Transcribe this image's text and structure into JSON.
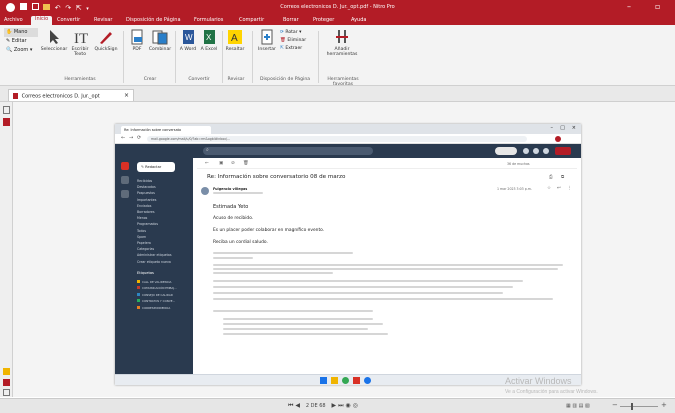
{
  "app": {
    "title": "Correos electronicos D. Jur._opt.pdf - Nitro Pro",
    "quick_icons": [
      "save-icon",
      "print-icon",
      "folder-icon",
      "undo-icon",
      "redo-icon",
      "pointer-icon",
      "dropdown-icon"
    ]
  },
  "menu": {
    "tabs": [
      "Archivo",
      "Inicio",
      "Convertir",
      "Revisar",
      "Disposición de Página",
      "Formularios",
      "Compartir",
      "Borrar",
      "Proteger",
      "Ayuda"
    ],
    "active": "Inicio"
  },
  "ribbon": {
    "left_tools": [
      "Mano",
      "Editar",
      "Zoom"
    ],
    "herramientas": [
      "Seleccionar",
      "Escribir Texto",
      "QuickSign"
    ],
    "crear": [
      "PDF",
      "Combinar"
    ],
    "convertir": [
      "A Word",
      "A Excel"
    ],
    "revisar": [
      "Resaltar"
    ],
    "disposicion": [
      "Insertar",
      "Rotar",
      "Eliminar",
      "Extraer"
    ],
    "favoritas": [
      "Añadir herramientas"
    ],
    "groups": [
      "Herramientas",
      "Crear",
      "Convertir",
      "Revisar",
      "Disposición de Página",
      "Herramientas favoritas"
    ]
  },
  "document": {
    "tab_label": "Correos electronicos D. Jur._opt"
  },
  "email": {
    "browser_tab": "Re: Información sobre conversato",
    "url": "mail.google.com/mail/u/0/?ab=rm&ogbl#inbox/...",
    "subject": "Re: Información sobre conversatorio 08 de marzo",
    "sender": "Fulgencio villegas",
    "date": "1 mar 2023 3:03 p.m.",
    "greeting": "Estimada Yeto",
    "line1": "Acuso de recibido.",
    "line2": "Es un placer poder colaborar en magnífico evento.",
    "line3": "Reciba un cordial saludo.",
    "sidebar_items": [
      "Recibidos",
      "Destacados",
      "Pospuestos",
      "Importantes",
      "Enviados",
      "Borradores",
      "Menos",
      "Programados",
      "Todos",
      "Spam",
      "Papelera",
      "Categorías",
      "Administrar etiquetas",
      "Crear etiqueta nueva"
    ],
    "labels_title": "Etiquetas",
    "labels": [
      "CALL DE VALIDENCIA",
      "COMUNICACIÓN EMBAJ...",
      "CONSEJO DE CALIDAD",
      "CONTRATOS Y CONVE...",
      "CORRESPONDENCIA"
    ],
    "label_colors": [
      "#f0b400",
      "#c0392b",
      "#2e86c1",
      "#27ae60",
      "#e67e22"
    ],
    "compose": "Redactar",
    "counter": "36 de muchas"
  },
  "status": {
    "page": "2 DE 68",
    "zoom_minus": "−",
    "zoom_plus": "+",
    "zoom_pct": "100"
  },
  "watermark": {
    "title": "Activar Windows",
    "subtitle": "Ve a Configuración para activar Windows."
  },
  "colors": {
    "brand": "#b31c26",
    "gmail_header": "#1a73e8"
  }
}
